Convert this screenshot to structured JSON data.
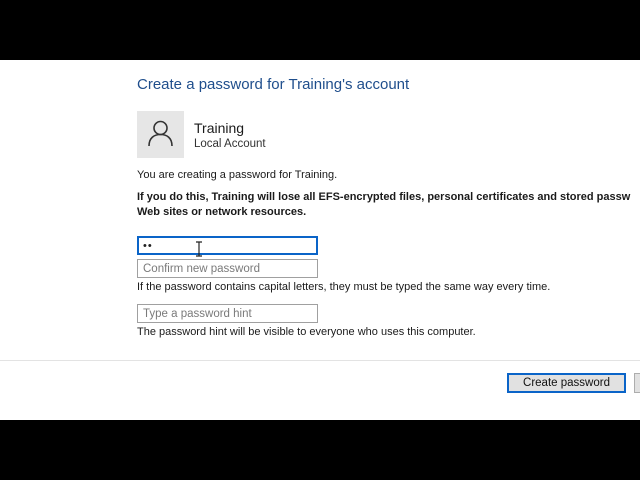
{
  "dialog": {
    "title": "Create a password for Training's account",
    "account_name": "Training",
    "account_type": "Local Account",
    "creating_message": "You are creating a password for Training.",
    "warning_line1": "If you do this, Training will lose all EFS-encrypted files, personal certificates and stored passw",
    "warning_line2": "Web sites or network resources."
  },
  "form": {
    "new_password_value": "••",
    "confirm_placeholder": "Confirm new password",
    "capital_letters_note": "If the password contains capital letters, they must be typed the same way every time.",
    "hint_placeholder": "Type a password hint",
    "hint_visibility_note": "The password hint will be visible to everyone who uses this computer."
  },
  "buttons": {
    "create_password_label": "Create password",
    "cancel_label": ""
  },
  "icons": {
    "avatar": "user-icon",
    "cursor": "text-cursor-icon"
  }
}
